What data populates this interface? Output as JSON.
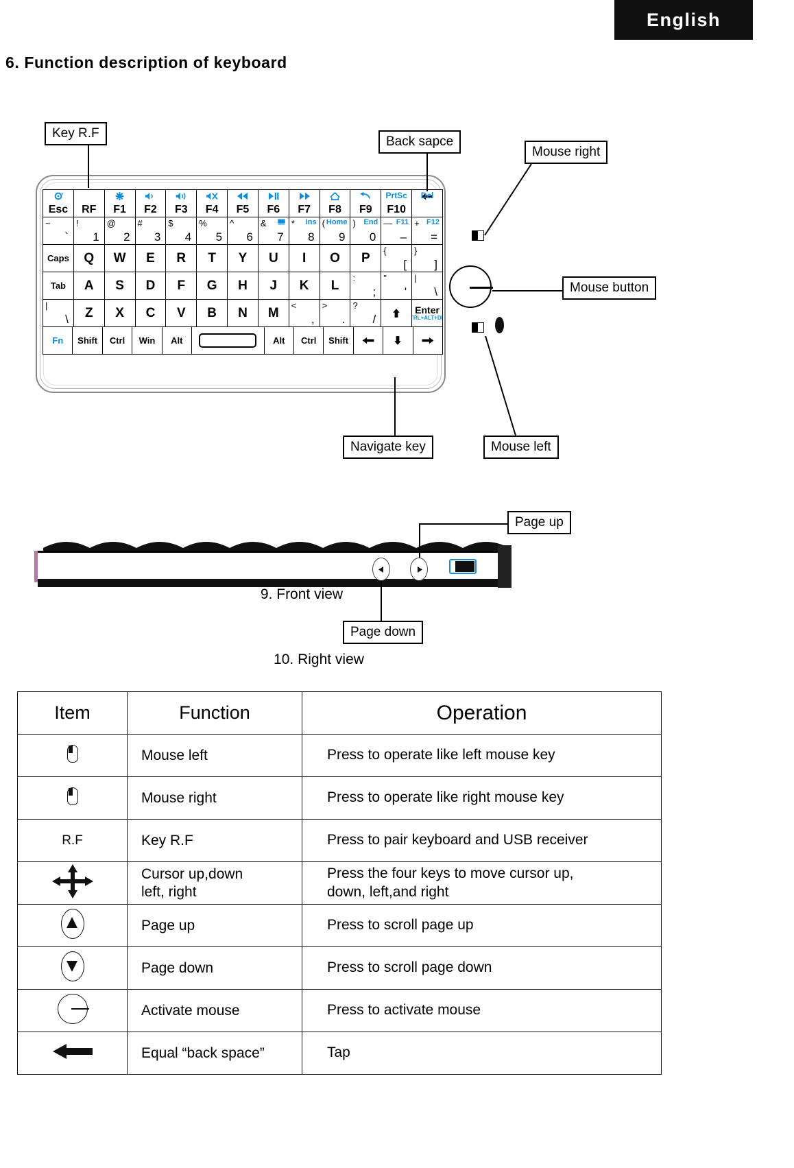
{
  "page": {
    "language_tab": "English",
    "section_title": "6. Function description of keyboard",
    "front_view_caption": "9. Front view",
    "right_view_caption": "10. Right view"
  },
  "callouts": {
    "key_rf": "Key R.F",
    "back_space": "Back sapce",
    "mouse_right": "Mouse right",
    "mouse_button": "Mouse button",
    "mouse_left": "Mouse left",
    "navigate_key": "Navigate key",
    "page_up": "Page up",
    "page_down": "Page down"
  },
  "keyboard": {
    "rows": [
      [
        {
          "icon": "refresh-icon",
          "main": "Esc"
        },
        {
          "main": "RF"
        },
        {
          "icon": "brightness-icon",
          "main": "F1"
        },
        {
          "icon": "volume-low-icon",
          "main": "F2"
        },
        {
          "icon": "volume-high-icon",
          "main": "F3"
        },
        {
          "icon": "volume-mute-icon",
          "main": "F4"
        },
        {
          "icon": "prev-track-icon",
          "main": "F5"
        },
        {
          "icon": "play-pause-icon",
          "main": "F6"
        },
        {
          "icon": "next-track-icon",
          "main": "F7"
        },
        {
          "icon": "home-icon",
          "main": "F8"
        },
        {
          "icon": "back-icon",
          "main": "F9"
        },
        {
          "top": "PrtSc",
          "main": "F10"
        },
        {
          "top": "Del",
          "icon": "left-arrow-icon"
        }
      ],
      [
        {
          "tl": "~",
          "br": "`"
        },
        {
          "tl": "!",
          "br": "1"
        },
        {
          "tl": "@",
          "br": "2"
        },
        {
          "tl": "#",
          "br": "3"
        },
        {
          "tl": "$",
          "br": "4"
        },
        {
          "tl": "%",
          "br": "5"
        },
        {
          "tl": "^",
          "br": "6"
        },
        {
          "tl": "&",
          "tr_icon": "screen-icon",
          "br": "7"
        },
        {
          "tl": "*",
          "tr": "Ins",
          "br": "8"
        },
        {
          "tl": "(",
          "tr": "Home",
          "br": "9"
        },
        {
          "tl": ")",
          "tr": "End",
          "br": "0"
        },
        {
          "tl": "—",
          "tr": "F11",
          "br": "–"
        },
        {
          "tl": "+",
          "tr": "F12",
          "br": "="
        }
      ],
      [
        {
          "center": "Caps",
          "small": true
        },
        {
          "center": "Q"
        },
        {
          "center": "W"
        },
        {
          "center": "E"
        },
        {
          "center": "R"
        },
        {
          "center": "T"
        },
        {
          "center": "Y"
        },
        {
          "center": "U"
        },
        {
          "center": "I"
        },
        {
          "center": "O"
        },
        {
          "center": "P"
        },
        {
          "tl": "{",
          "br": "["
        },
        {
          "tl": "}",
          "br": "]"
        }
      ],
      [
        {
          "center": "Tab",
          "small": true
        },
        {
          "center": "A"
        },
        {
          "center": "S"
        },
        {
          "center": "D"
        },
        {
          "center": "F"
        },
        {
          "center": "G"
        },
        {
          "center": "H"
        },
        {
          "center": "J"
        },
        {
          "center": "K"
        },
        {
          "center": "L"
        },
        {
          "tl": ":",
          "br": ";"
        },
        {
          "tl": "\"",
          "br": "'"
        },
        {
          "tl": "|",
          "br": "\\"
        }
      ],
      [
        {
          "tl": "|",
          "br": "\\"
        },
        {
          "center": "Z"
        },
        {
          "center": "X"
        },
        {
          "center": "C"
        },
        {
          "center": "V"
        },
        {
          "center": "B"
        },
        {
          "center": "N"
        },
        {
          "center": "M"
        },
        {
          "tl": "<",
          "br": ","
        },
        {
          "tl": ">",
          "br": "."
        },
        {
          "tl": "?",
          "br": "/"
        },
        {
          "glyph": "up-arrow-icon"
        },
        {
          "center": "Enter",
          "sub": "CTRL+ALT+DEL",
          "small": true
        }
      ],
      [
        {
          "center": "Fn",
          "blue": true,
          "small": true
        },
        {
          "center": "Shift",
          "small": true
        },
        {
          "center": "Ctrl",
          "small": true
        },
        {
          "center": "Win",
          "small": true
        },
        {
          "center": "Alt",
          "small": true
        },
        {
          "spacebar": true
        },
        {
          "center": "Alt",
          "small": true
        },
        {
          "center": "Ctrl",
          "small": true
        },
        {
          "center": "Shift",
          "small": true
        },
        {
          "glyph": "left-arrow-icon"
        },
        {
          "glyph": "down-arrow-icon"
        },
        {
          "glyph": "right-arrow-icon"
        }
      ]
    ]
  },
  "table": {
    "headers": [
      "Item",
      "Function",
      "Operation"
    ],
    "rows": [
      {
        "icon": "mouse-left-icon",
        "function": "Mouse left",
        "operation": "Press to operate like left mouse key"
      },
      {
        "icon": "mouse-right-icon",
        "function": "Mouse right",
        "operation": "Press to operate like right mouse key"
      },
      {
        "icon": "rf-text-icon",
        "icon_text": "R.F",
        "function": "Key R.F",
        "operation": "Press to pair keyboard and USB receiver"
      },
      {
        "icon": "four-way-arrows-icon",
        "function": "Cursor up,down\nleft, right",
        "operation": "Press the four keys to move cursor up,\ndown, left,and right"
      },
      {
        "icon": "circle-up-arrow-icon",
        "function": "Page up",
        "operation": "Press to scroll page up"
      },
      {
        "icon": "circle-down-arrow-icon",
        "function": "Page down",
        "operation": "Press to scroll page down"
      },
      {
        "icon": "activate-mouse-icon",
        "function": "Activate mouse",
        "operation": "Press to activate mouse"
      },
      {
        "icon": "back-arrow-icon",
        "function": "Equal “back space”",
        "operation": "Tap"
      }
    ]
  },
  "colors": {
    "accent_blue": "#0a8edc",
    "tab_black": "#111111"
  }
}
